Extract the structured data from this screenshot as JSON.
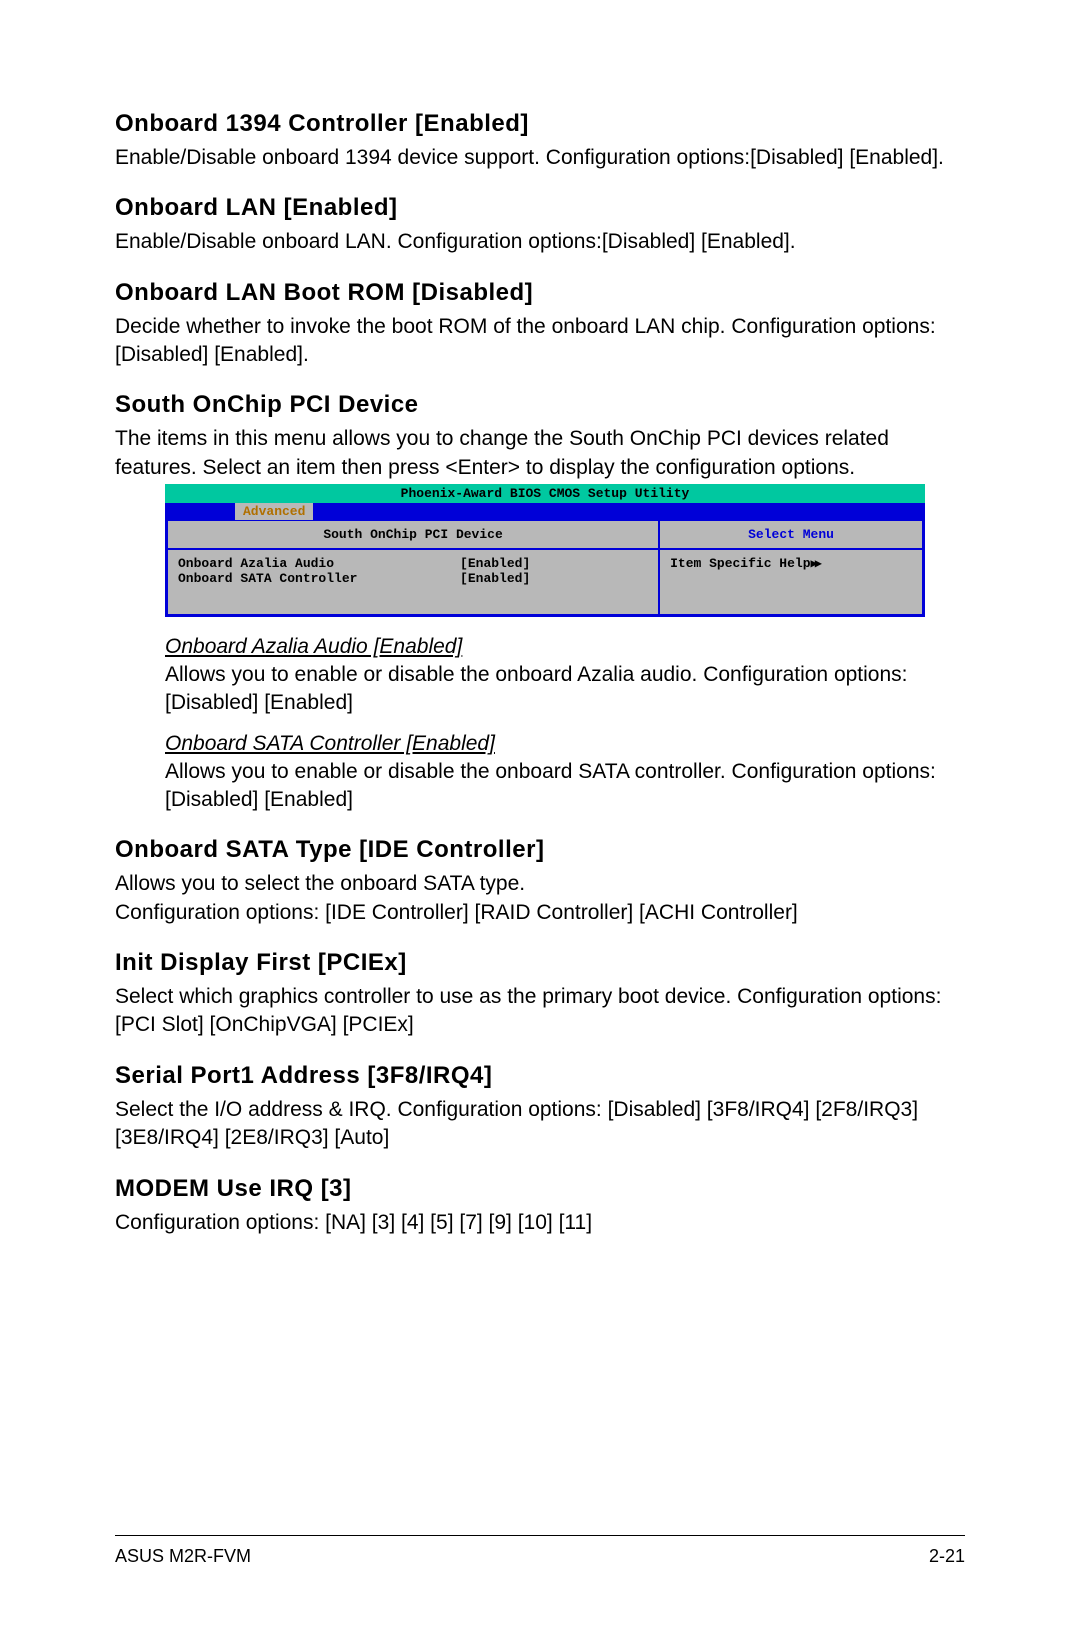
{
  "sections": {
    "s1": {
      "heading": "Onboard 1394 Controller [Enabled]",
      "body": "Enable/Disable onboard 1394 device support. Configuration options:[Disabled] [Enabled]."
    },
    "s2": {
      "heading": "Onboard LAN [Enabled]",
      "body": "Enable/Disable onboard LAN. Configuration options:[Disabled] [Enabled]."
    },
    "s3": {
      "heading": "Onboard LAN Boot ROM [Disabled]",
      "body": "Decide whether to invoke the boot ROM of the onboard LAN chip. Configuration options:[Disabled] [Enabled]."
    },
    "s4": {
      "heading": "South OnChip PCI Device",
      "body": "The items in this menu allows you to change the South OnChip PCI devices related features. Select an item then press <Enter> to display the configuration options."
    },
    "s5": {
      "heading": "Onboard SATA Type [IDE Controller]",
      "body": "Allows you to select the onboard SATA type.\nConfiguration options: [IDE Controller] [RAID Controller] [ACHI Controller]"
    },
    "s6": {
      "heading": "Init Display First [PCIEx]",
      "body": "Select which graphics controller to use as the primary boot device. Configuration options: [PCI Slot] [OnChipVGA] [PCIEx]"
    },
    "s7": {
      "heading": "Serial Port1 Address [3F8/IRQ4]",
      "body": "Select the I/O address & IRQ. Configuration options: [Disabled] [3F8/IRQ4] [2F8/IRQ3] [3E8/IRQ4] [2E8/IRQ3] [Auto]"
    },
    "s8": {
      "heading": "MODEM Use IRQ [3]",
      "body": "Configuration options: [NA] [3] [4] [5] [7] [9] [10] [11]"
    }
  },
  "subsections": {
    "a1": {
      "heading": "Onboard Azalia Audio [Enabled]",
      "body": "Allows you to enable or disable the onboard Azalia audio. Configuration options: [Disabled] [Enabled]"
    },
    "a2": {
      "heading": "Onboard SATA Controller [Enabled]",
      "body": "Allows you to enable or disable the onboard SATA controller. Configuration options: [Disabled] [Enabled]"
    }
  },
  "bios": {
    "title": "Phoenix-Award BIOS CMOS Setup Utility",
    "tab": "Advanced",
    "left_header": "South OnChip PCI Device",
    "right_header": "Select Menu",
    "help_label": "Item Specific Help",
    "rows": [
      {
        "k": "Onboard Azalia Audio",
        "v": "[Enabled]"
      },
      {
        "k": "Onboard SATA Controller",
        "v": "[Enabled]"
      }
    ]
  },
  "footer": {
    "left": "ASUS M2R-FVM",
    "right": "2-21"
  }
}
